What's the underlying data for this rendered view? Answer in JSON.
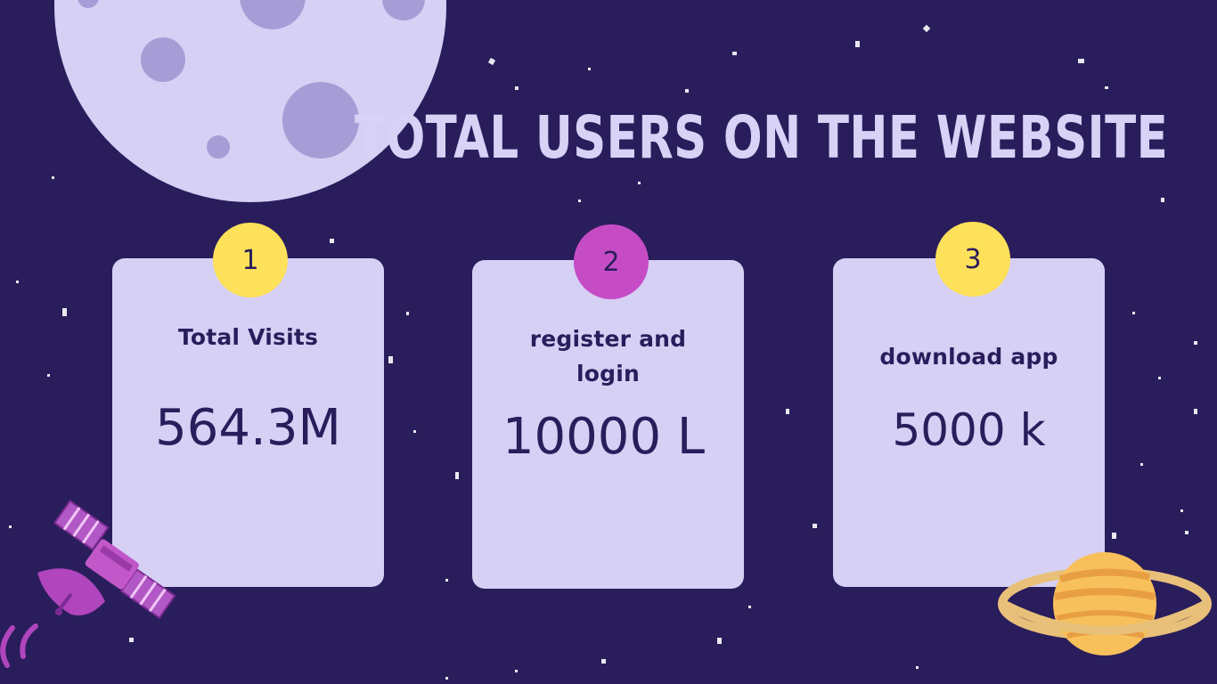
{
  "slide": {
    "title": "TOTAL USERS ON THE WEBSITE",
    "cards": [
      {
        "number": "1",
        "label": "Total Visits",
        "value": "564.3M",
        "badge_color": "#fde15a"
      },
      {
        "number": "2",
        "label": "register and login",
        "value": "10000 L",
        "badge_color": "#c64cc6"
      },
      {
        "number": "3",
        "label": "download app",
        "value": "5000 k",
        "badge_color": "#fde15a"
      }
    ]
  },
  "colors": {
    "background": "#2a1d5c",
    "card": "#d6d0f5",
    "text_dark": "#2a1d5c",
    "title": "#d8d2f6",
    "accent_yellow": "#fde15a",
    "accent_magenta": "#c64cc6"
  },
  "icons": [
    "moon-illustration",
    "satellite-illustration",
    "saturn-illustration",
    "star-icon"
  ]
}
